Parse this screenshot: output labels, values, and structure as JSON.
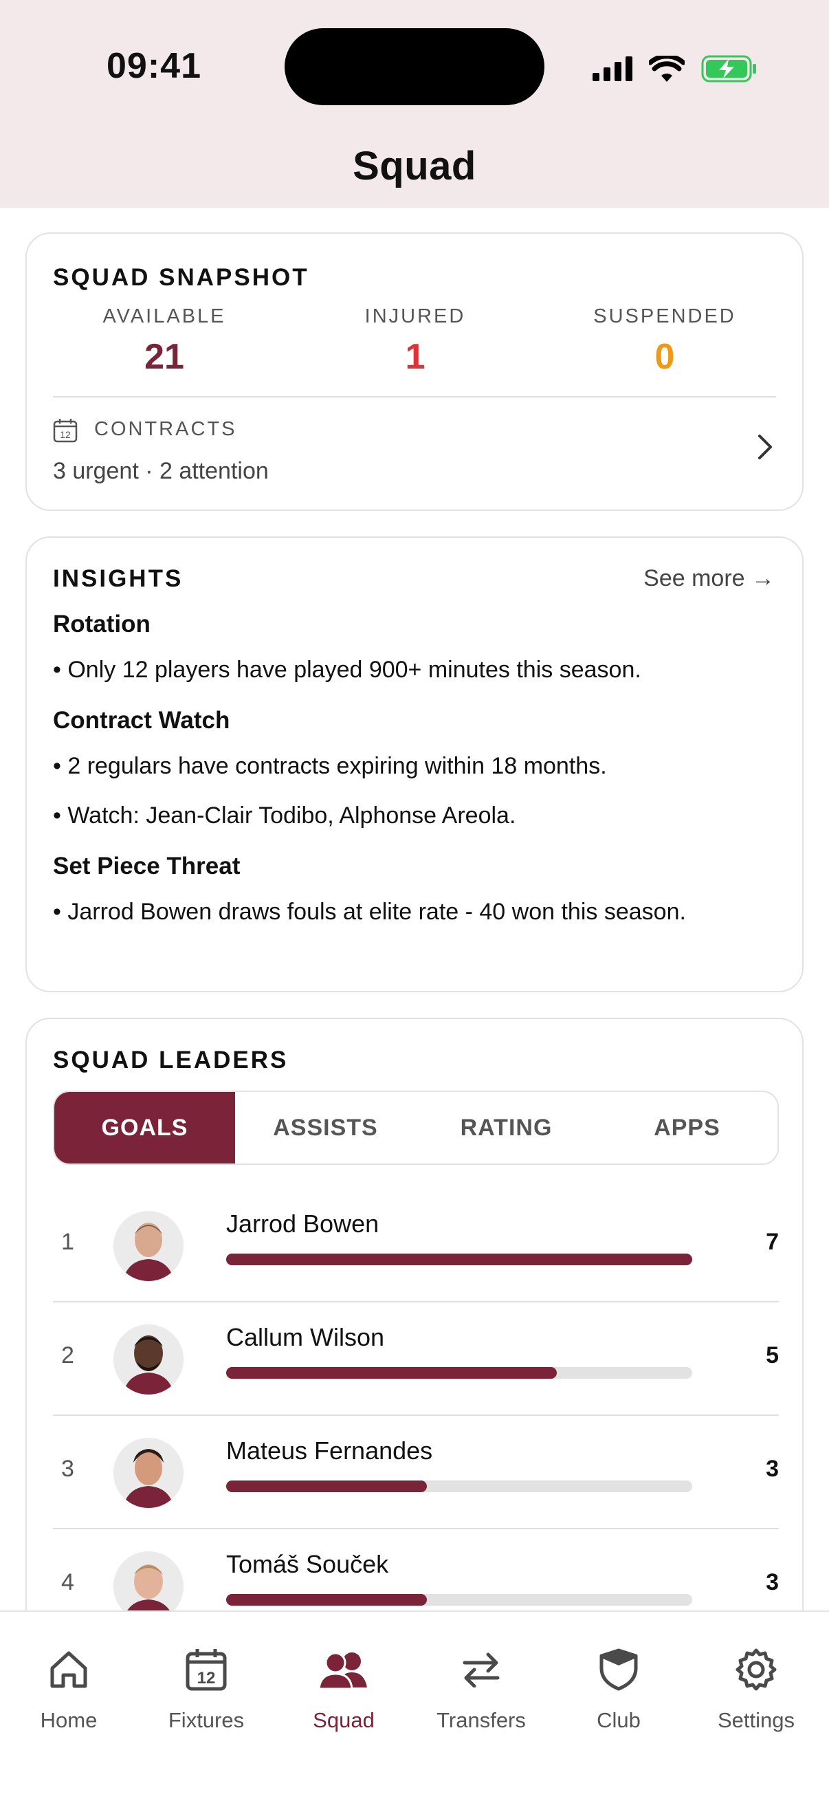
{
  "status_bar": {
    "time": "09:41"
  },
  "header": {
    "title": "Squad"
  },
  "snapshot": {
    "title": "SQUAD SNAPSHOT",
    "stats": [
      {
        "label": "AVAILABLE",
        "value": "21",
        "color": "#7b2439"
      },
      {
        "label": "INJURED",
        "value": "1",
        "color": "#e0323a"
      },
      {
        "label": "SUSPENDED",
        "value": "0",
        "color": "#ef9a12"
      }
    ],
    "contracts_label": "CONTRACTS",
    "contracts_summary": "3 urgent · 2 attention",
    "calendar_icon_day": "12"
  },
  "insights": {
    "title": "INSIGHTS",
    "see_more": "See more →",
    "sections": [
      {
        "heading": "Rotation",
        "lines": [
          "• Only 12 players have played 900+ minutes this season."
        ]
      },
      {
        "heading": "Contract Watch",
        "lines": [
          "• 2 regulars have contracts expiring within 18 months.",
          "• Watch: Jean-Clair Todibo, Alphonse Areola."
        ]
      },
      {
        "heading": "Set Piece Threat",
        "lines": [
          "• Jarrod Bowen draws fouls at elite rate - 40 won this season."
        ]
      }
    ]
  },
  "leaders": {
    "title": "SQUAD LEADERS",
    "tabs": [
      "GOALS",
      "ASSISTS",
      "RATING",
      "APPS"
    ],
    "active_tab": "GOALS",
    "rows": [
      {
        "rank": "1",
        "name": "Jarrod Bowen",
        "value": "7",
        "fill": 1.0
      },
      {
        "rank": "2",
        "name": "Callum Wilson",
        "value": "5",
        "fill": 0.71
      },
      {
        "rank": "3",
        "name": "Mateus Fernandes",
        "value": "3",
        "fill": 0.43
      },
      {
        "rank": "4",
        "name": "Tomáš Souček",
        "value": "3",
        "fill": 0.43
      }
    ]
  },
  "nav": {
    "items": [
      {
        "label": "Home",
        "icon": "home-icon"
      },
      {
        "label": "Fixtures",
        "icon": "calendar-icon"
      },
      {
        "label": "Squad",
        "icon": "people-icon"
      },
      {
        "label": "Transfers",
        "icon": "swap-arrows-icon"
      },
      {
        "label": "Club",
        "icon": "shield-icon"
      },
      {
        "label": "Settings",
        "icon": "gear-icon"
      }
    ],
    "active": "Squad",
    "calendar_day": "12"
  },
  "colors": {
    "accent": "#7b2439",
    "injured": "#e0323a",
    "suspended": "#ef9a12"
  }
}
